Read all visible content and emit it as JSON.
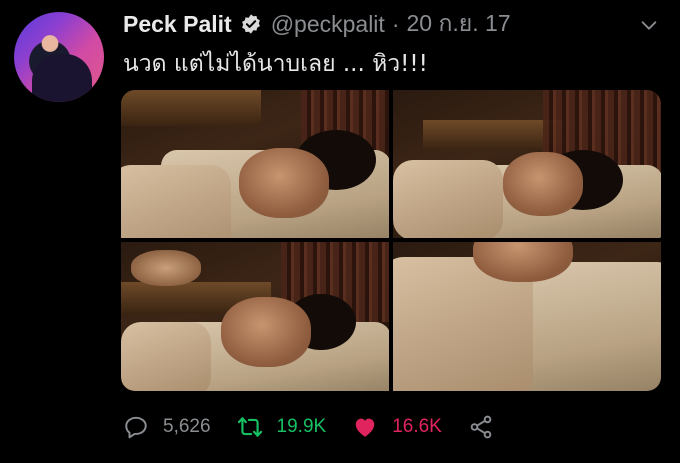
{
  "user": {
    "name": "Peck Palit",
    "handle": "@peckpalit",
    "separator": "·",
    "date": "20 ก.ย. 17"
  },
  "tweet": {
    "text": "นวด แต่ไม่ได้นาบเลย ... หิว!!!"
  },
  "actions": {
    "replies": "5,626",
    "retweets": "19.9K",
    "likes": "16.6K"
  },
  "colors": {
    "background": "#000000",
    "verified": "#d9d9d9",
    "retweet": "#17bf63",
    "like": "#e0245e",
    "muted": "#8a8d91"
  },
  "icons": [
    "verified-badge-icon",
    "chevron-down-icon",
    "reply-icon",
    "retweet-icon",
    "heart-icon",
    "share-icon"
  ]
}
